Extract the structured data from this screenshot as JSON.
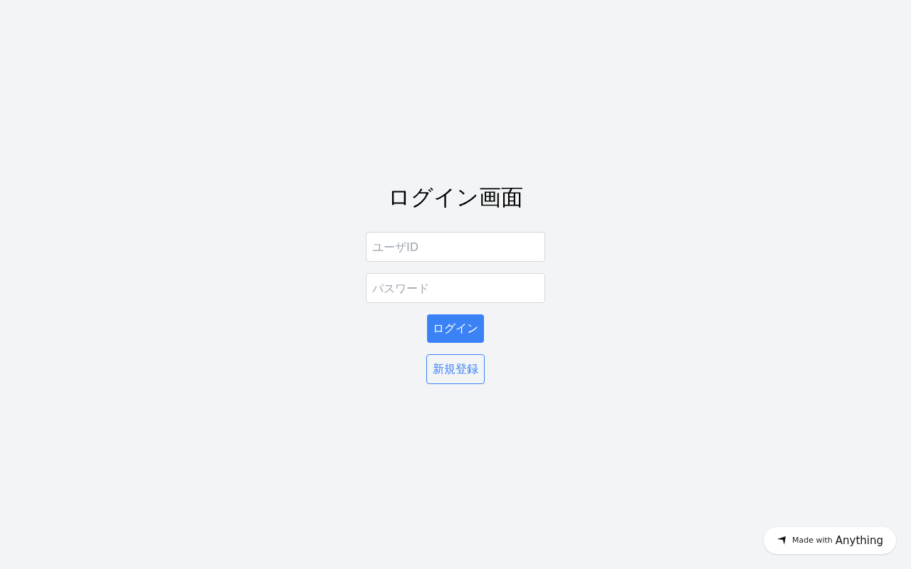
{
  "title": "ログイン画面",
  "fields": [
    {
      "placeholder": "ユーザID"
    },
    {
      "placeholder": "パスワード"
    }
  ],
  "login_button": "ログイン",
  "register_button": "新規登録",
  "badge": {
    "prefix": "Made with",
    "brand": "Anything"
  }
}
